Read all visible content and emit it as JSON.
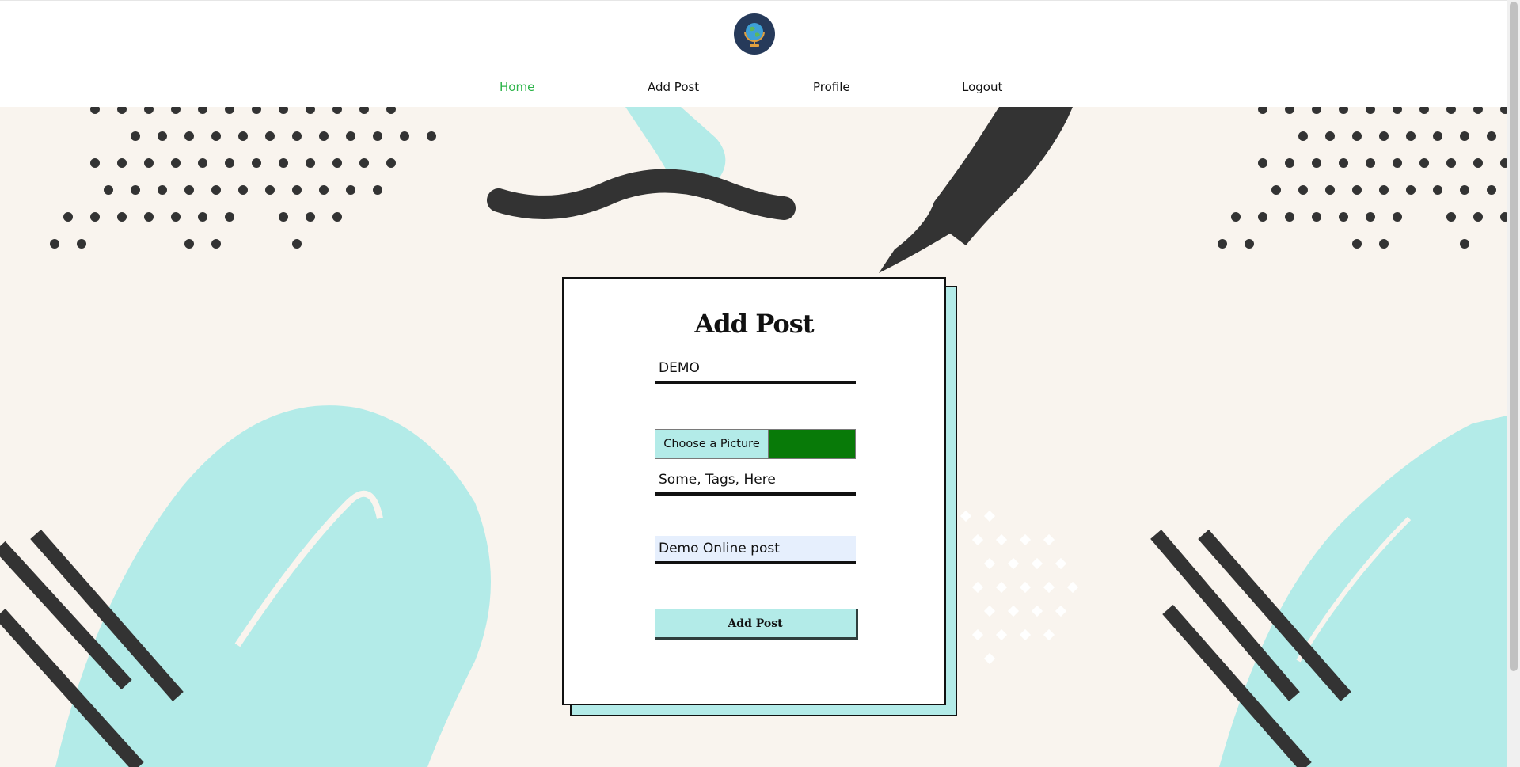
{
  "nav": {
    "items": [
      {
        "label": "Home",
        "active": true
      },
      {
        "label": "Add Post",
        "active": false
      },
      {
        "label": "Profile",
        "active": false
      },
      {
        "label": "Logout",
        "active": false
      }
    ]
  },
  "logo": {
    "icon": "globe-icon"
  },
  "form": {
    "title": "Add Post",
    "title_value": "DEMO",
    "file_button_label": "Choose a Picture",
    "tags_value": "Some, Tags, Here",
    "description_value": "Demo Online post",
    "submit_label": "Add Post"
  },
  "colors": {
    "accent": "#b3ebe8",
    "active_nav": "#2db44a",
    "file_fill": "#087a08",
    "background": "#f9f4ee",
    "dark": "#333333"
  }
}
